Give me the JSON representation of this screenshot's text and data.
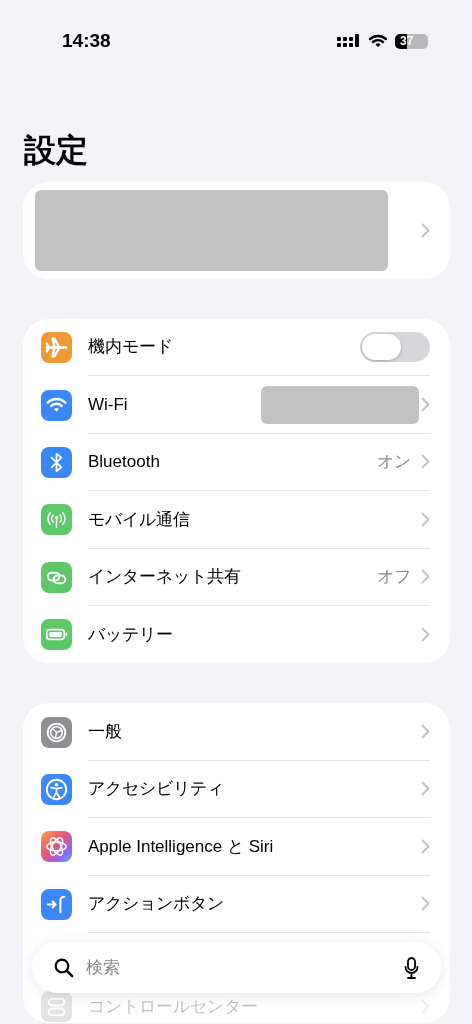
{
  "status_bar": {
    "time": "14:38",
    "battery": "37"
  },
  "title": "設定",
  "profile": {
    "redacted": true
  },
  "groups": [
    {
      "rows": [
        {
          "label": "機内モード",
          "color": "#f09a37",
          "kind": "toggle",
          "on": false
        },
        {
          "label": "Wi-Fi",
          "color": "#3c87f7",
          "kind": "link",
          "redacted": true
        },
        {
          "label": "Bluetooth",
          "color": "#3c87f7",
          "kind": "link",
          "value": "オン"
        },
        {
          "label": "モバイル通信",
          "color": "#5dc866",
          "kind": "link"
        },
        {
          "label": "インターネット共有",
          "color": "#5dc866",
          "kind": "link",
          "value": "オフ"
        },
        {
          "label": "バッテリー",
          "color": "#5dc866",
          "kind": "link"
        }
      ]
    },
    {
      "rows": [
        {
          "label": "一般",
          "color": "#8e8e93",
          "kind": "link"
        },
        {
          "label": "アクセシビリティ",
          "color": "#3c87f7",
          "kind": "link"
        },
        {
          "label": "Apple Intelligence と Siri",
          "kind": "link"
        },
        {
          "label": "アクションボタン",
          "color": "#3c87f7",
          "kind": "link"
        },
        {
          "label": "コントロールセンター",
          "kind": "link",
          "covered": true
        }
      ]
    }
  ],
  "search": {
    "placeholder": "検索"
  }
}
